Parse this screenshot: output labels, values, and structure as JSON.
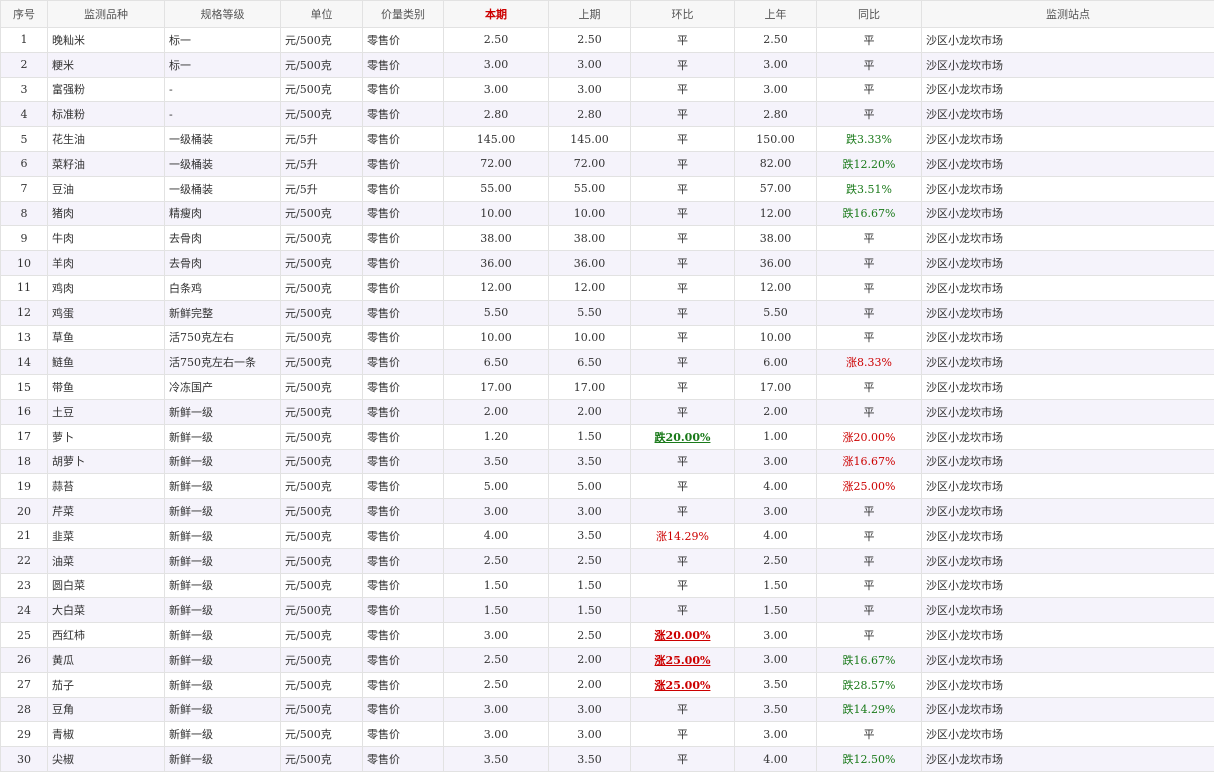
{
  "headers": [
    "序号",
    "监测品种",
    "规格等级",
    "单位",
    "价量类别",
    "本期",
    "上期",
    "环比",
    "上年",
    "同比",
    "监测站点"
  ],
  "rows": [
    {
      "no": "1",
      "item": "晚籼米",
      "grade": "标一",
      "unit": "元/500克",
      "type": "零售价",
      "cur": "2.50",
      "prev": "2.50",
      "mom": {
        "text": "平",
        "dir": "flat"
      },
      "last_year": "2.50",
      "yoy": {
        "text": "平",
        "dir": "flat"
      },
      "site": "沙区小龙坎市场"
    },
    {
      "no": "2",
      "item": "粳米",
      "grade": "标一",
      "unit": "元/500克",
      "type": "零售价",
      "cur": "3.00",
      "prev": "3.00",
      "mom": {
        "text": "平",
        "dir": "flat"
      },
      "last_year": "3.00",
      "yoy": {
        "text": "平",
        "dir": "flat"
      },
      "site": "沙区小龙坎市场"
    },
    {
      "no": "3",
      "item": "富强粉",
      "grade": "-",
      "unit": "元/500克",
      "type": "零售价",
      "cur": "3.00",
      "prev": "3.00",
      "mom": {
        "text": "平",
        "dir": "flat"
      },
      "last_year": "3.00",
      "yoy": {
        "text": "平",
        "dir": "flat"
      },
      "site": "沙区小龙坎市场"
    },
    {
      "no": "4",
      "item": "标准粉",
      "grade": "-",
      "unit": "元/500克",
      "type": "零售价",
      "cur": "2.80",
      "prev": "2.80",
      "mom": {
        "text": "平",
        "dir": "flat"
      },
      "last_year": "2.80",
      "yoy": {
        "text": "平",
        "dir": "flat"
      },
      "site": "沙区小龙坎市场"
    },
    {
      "no": "5",
      "item": "花生油",
      "grade": "一级桶装",
      "unit": "元/5升",
      "type": "零售价",
      "cur": "145.00",
      "prev": "145.00",
      "mom": {
        "text": "平",
        "dir": "flat"
      },
      "last_year": "150.00",
      "yoy": {
        "text": "跌3.33%",
        "dir": "down"
      },
      "site": "沙区小龙坎市场"
    },
    {
      "no": "6",
      "item": "菜籽油",
      "grade": "一级桶装",
      "unit": "元/5升",
      "type": "零售价",
      "cur": "72.00",
      "prev": "72.00",
      "mom": {
        "text": "平",
        "dir": "flat"
      },
      "last_year": "82.00",
      "yoy": {
        "text": "跌12.20%",
        "dir": "down"
      },
      "site": "沙区小龙坎市场"
    },
    {
      "no": "7",
      "item": "豆油",
      "grade": "一级桶装",
      "unit": "元/5升",
      "type": "零售价",
      "cur": "55.00",
      "prev": "55.00",
      "mom": {
        "text": "平",
        "dir": "flat"
      },
      "last_year": "57.00",
      "yoy": {
        "text": "跌3.51%",
        "dir": "down"
      },
      "site": "沙区小龙坎市场"
    },
    {
      "no": "8",
      "item": "猪肉",
      "grade": "精瘦肉",
      "unit": "元/500克",
      "type": "零售价",
      "cur": "10.00",
      "prev": "10.00",
      "mom": {
        "text": "平",
        "dir": "flat"
      },
      "last_year": "12.00",
      "yoy": {
        "text": "跌16.67%",
        "dir": "down"
      },
      "site": "沙区小龙坎市场"
    },
    {
      "no": "9",
      "item": "牛肉",
      "grade": "去骨肉",
      "unit": "元/500克",
      "type": "零售价",
      "cur": "38.00",
      "prev": "38.00",
      "mom": {
        "text": "平",
        "dir": "flat"
      },
      "last_year": "38.00",
      "yoy": {
        "text": "平",
        "dir": "flat"
      },
      "site": "沙区小龙坎市场"
    },
    {
      "no": "10",
      "item": "羊肉",
      "grade": "去骨肉",
      "unit": "元/500克",
      "type": "零售价",
      "cur": "36.00",
      "prev": "36.00",
      "mom": {
        "text": "平",
        "dir": "flat"
      },
      "last_year": "36.00",
      "yoy": {
        "text": "平",
        "dir": "flat"
      },
      "site": "沙区小龙坎市场"
    },
    {
      "no": "11",
      "item": "鸡肉",
      "grade": "白条鸡",
      "unit": "元/500克",
      "type": "零售价",
      "cur": "12.00",
      "prev": "12.00",
      "mom": {
        "text": "平",
        "dir": "flat"
      },
      "last_year": "12.00",
      "yoy": {
        "text": "平",
        "dir": "flat"
      },
      "site": "沙区小龙坎市场"
    },
    {
      "no": "12",
      "item": "鸡蛋",
      "grade": "新鲜完整",
      "unit": "元/500克",
      "type": "零售价",
      "cur": "5.50",
      "prev": "5.50",
      "mom": {
        "text": "平",
        "dir": "flat"
      },
      "last_year": "5.50",
      "yoy": {
        "text": "平",
        "dir": "flat"
      },
      "site": "沙区小龙坎市场"
    },
    {
      "no": "13",
      "item": "草鱼",
      "grade": "活750克左右",
      "unit": "元/500克",
      "type": "零售价",
      "cur": "10.00",
      "prev": "10.00",
      "mom": {
        "text": "平",
        "dir": "flat"
      },
      "last_year": "10.00",
      "yoy": {
        "text": "平",
        "dir": "flat"
      },
      "site": "沙区小龙坎市场"
    },
    {
      "no": "14",
      "item": "鲢鱼",
      "grade": "活750克左右一条",
      "unit": "元/500克",
      "type": "零售价",
      "cur": "6.50",
      "prev": "6.50",
      "mom": {
        "text": "平",
        "dir": "flat"
      },
      "last_year": "6.00",
      "yoy": {
        "text": "涨8.33%",
        "dir": "up"
      },
      "site": "沙区小龙坎市场"
    },
    {
      "no": "15",
      "item": "带鱼",
      "grade": "冷冻国产",
      "unit": "元/500克",
      "type": "零售价",
      "cur": "17.00",
      "prev": "17.00",
      "mom": {
        "text": "平",
        "dir": "flat"
      },
      "last_year": "17.00",
      "yoy": {
        "text": "平",
        "dir": "flat"
      },
      "site": "沙区小龙坎市场"
    },
    {
      "no": "16",
      "item": "土豆",
      "grade": "新鲜一级",
      "unit": "元/500克",
      "type": "零售价",
      "cur": "2.00",
      "prev": "2.00",
      "mom": {
        "text": "平",
        "dir": "flat"
      },
      "last_year": "2.00",
      "yoy": {
        "text": "平",
        "dir": "flat"
      },
      "site": "沙区小龙坎市场"
    },
    {
      "no": "17",
      "item": "萝卜",
      "grade": "新鲜一级",
      "unit": "元/500克",
      "type": "零售价",
      "cur": "1.20",
      "prev": "1.50",
      "mom": {
        "text": "跌20.00%",
        "dir": "down",
        "emph": true
      },
      "last_year": "1.00",
      "yoy": {
        "text": "涨20.00%",
        "dir": "up"
      },
      "site": "沙区小龙坎市场"
    },
    {
      "no": "18",
      "item": "胡萝卜",
      "grade": "新鲜一级",
      "unit": "元/500克",
      "type": "零售价",
      "cur": "3.50",
      "prev": "3.50",
      "mom": {
        "text": "平",
        "dir": "flat"
      },
      "last_year": "3.00",
      "yoy": {
        "text": "涨16.67%",
        "dir": "up"
      },
      "site": "沙区小龙坎市场"
    },
    {
      "no": "19",
      "item": "蒜苔",
      "grade": "新鲜一级",
      "unit": "元/500克",
      "type": "零售价",
      "cur": "5.00",
      "prev": "5.00",
      "mom": {
        "text": "平",
        "dir": "flat"
      },
      "last_year": "4.00",
      "yoy": {
        "text": "涨25.00%",
        "dir": "up"
      },
      "site": "沙区小龙坎市场"
    },
    {
      "no": "20",
      "item": "芹菜",
      "grade": "新鲜一级",
      "unit": "元/500克",
      "type": "零售价",
      "cur": "3.00",
      "prev": "3.00",
      "mom": {
        "text": "平",
        "dir": "flat"
      },
      "last_year": "3.00",
      "yoy": {
        "text": "平",
        "dir": "flat"
      },
      "site": "沙区小龙坎市场"
    },
    {
      "no": "21",
      "item": "韭菜",
      "grade": "新鲜一级",
      "unit": "元/500克",
      "type": "零售价",
      "cur": "4.00",
      "prev": "3.50",
      "mom": {
        "text": "涨14.29%",
        "dir": "up"
      },
      "last_year": "4.00",
      "yoy": {
        "text": "平",
        "dir": "flat"
      },
      "site": "沙区小龙坎市场"
    },
    {
      "no": "22",
      "item": "油菜",
      "grade": "新鲜一级",
      "unit": "元/500克",
      "type": "零售价",
      "cur": "2.50",
      "prev": "2.50",
      "mom": {
        "text": "平",
        "dir": "flat"
      },
      "last_year": "2.50",
      "yoy": {
        "text": "平",
        "dir": "flat"
      },
      "site": "沙区小龙坎市场"
    },
    {
      "no": "23",
      "item": "圆白菜",
      "grade": "新鲜一级",
      "unit": "元/500克",
      "type": "零售价",
      "cur": "1.50",
      "prev": "1.50",
      "mom": {
        "text": "平",
        "dir": "flat"
      },
      "last_year": "1.50",
      "yoy": {
        "text": "平",
        "dir": "flat"
      },
      "site": "沙区小龙坎市场"
    },
    {
      "no": "24",
      "item": "大白菜",
      "grade": "新鲜一级",
      "unit": "元/500克",
      "type": "零售价",
      "cur": "1.50",
      "prev": "1.50",
      "mom": {
        "text": "平",
        "dir": "flat"
      },
      "last_year": "1.50",
      "yoy": {
        "text": "平",
        "dir": "flat"
      },
      "site": "沙区小龙坎市场"
    },
    {
      "no": "25",
      "item": "西红柿",
      "grade": "新鲜一级",
      "unit": "元/500克",
      "type": "零售价",
      "cur": "3.00",
      "prev": "2.50",
      "mom": {
        "text": "涨20.00%",
        "dir": "up",
        "emph": true
      },
      "last_year": "3.00",
      "yoy": {
        "text": "平",
        "dir": "flat"
      },
      "site": "沙区小龙坎市场"
    },
    {
      "no": "26",
      "item": "黄瓜",
      "grade": "新鲜一级",
      "unit": "元/500克",
      "type": "零售价",
      "cur": "2.50",
      "prev": "2.00",
      "mom": {
        "text": "涨25.00%",
        "dir": "up",
        "emph": true
      },
      "last_year": "3.00",
      "yoy": {
        "text": "跌16.67%",
        "dir": "down"
      },
      "site": "沙区小龙坎市场"
    },
    {
      "no": "27",
      "item": "茄子",
      "grade": "新鲜一级",
      "unit": "元/500克",
      "type": "零售价",
      "cur": "2.50",
      "prev": "2.00",
      "mom": {
        "text": "涨25.00%",
        "dir": "up",
        "emph": true
      },
      "last_year": "3.50",
      "yoy": {
        "text": "跌28.57%",
        "dir": "down"
      },
      "site": "沙区小龙坎市场"
    },
    {
      "no": "28",
      "item": "豆角",
      "grade": "新鲜一级",
      "unit": "元/500克",
      "type": "零售价",
      "cur": "3.00",
      "prev": "3.00",
      "mom": {
        "text": "平",
        "dir": "flat"
      },
      "last_year": "3.50",
      "yoy": {
        "text": "跌14.29%",
        "dir": "down"
      },
      "site": "沙区小龙坎市场"
    },
    {
      "no": "29",
      "item": "青椒",
      "grade": "新鲜一级",
      "unit": "元/500克",
      "type": "零售价",
      "cur": "3.00",
      "prev": "3.00",
      "mom": {
        "text": "平",
        "dir": "flat"
      },
      "last_year": "3.00",
      "yoy": {
        "text": "平",
        "dir": "flat"
      },
      "site": "沙区小龙坎市场"
    },
    {
      "no": "30",
      "item": "尖椒",
      "grade": "新鲜一级",
      "unit": "元/500克",
      "type": "零售价",
      "cur": "3.50",
      "prev": "3.50",
      "mom": {
        "text": "平",
        "dir": "flat"
      },
      "last_year": "4.00",
      "yoy": {
        "text": "跌12.50%",
        "dir": "down"
      },
      "site": "沙区小龙坎市场"
    }
  ],
  "colors": {
    "up": "#cc0000",
    "down": "#1a7a1a",
    "current_header": "#cc0000",
    "stripe": "#f5f3fb"
  }
}
